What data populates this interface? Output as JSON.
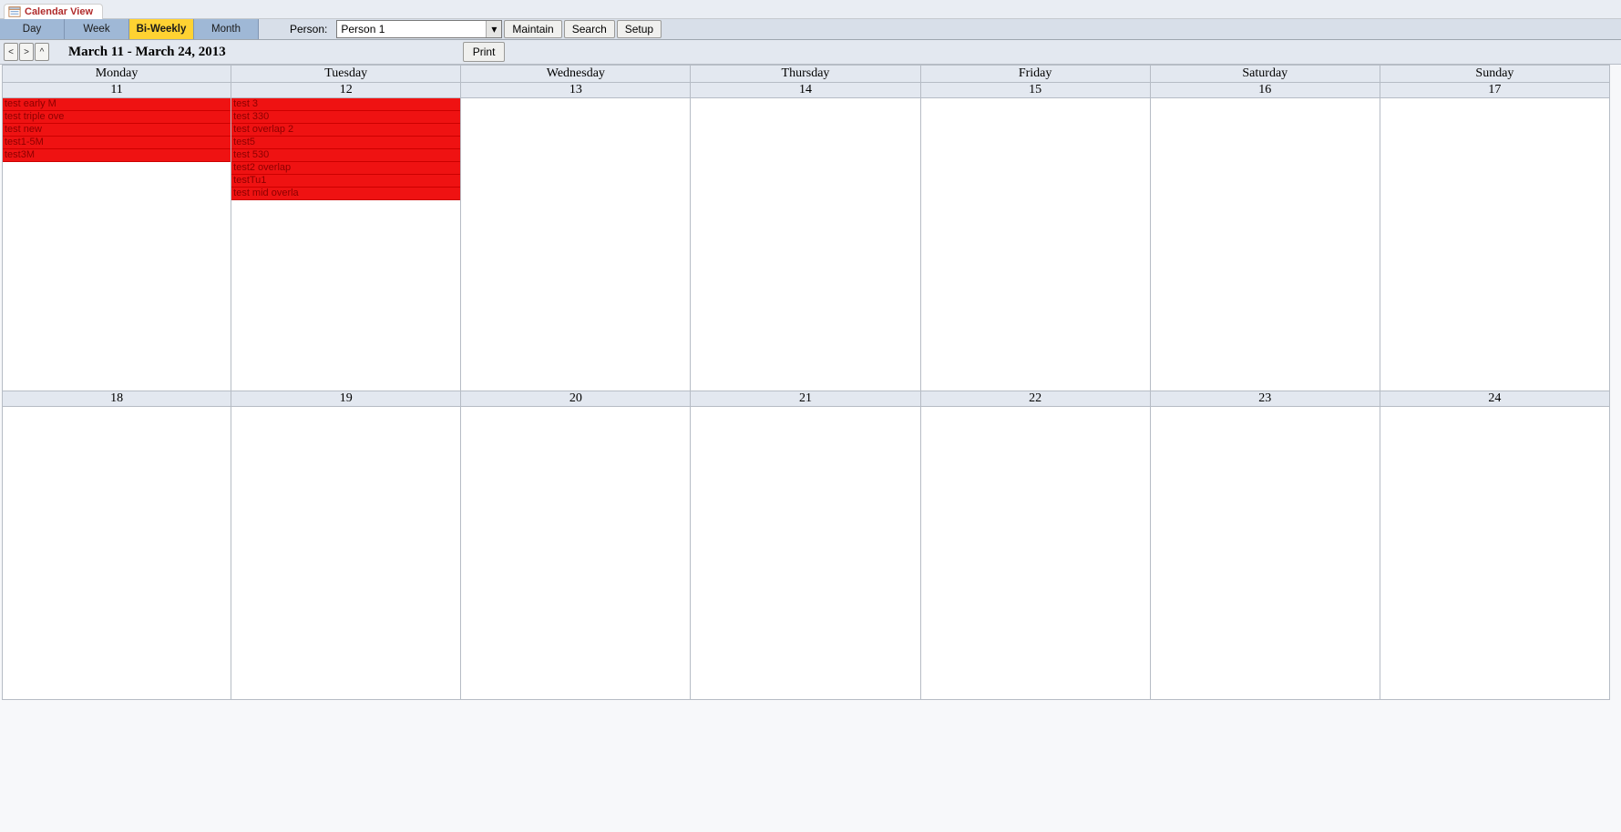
{
  "tab": {
    "title": "Calendar View"
  },
  "views": {
    "day": "Day",
    "week": "Week",
    "biweekly": "Bi-Weekly",
    "month": "Month"
  },
  "toolbar": {
    "person_label": "Person:",
    "person_selected": "Person 1",
    "maintain": "Maintain",
    "search": "Search",
    "setup": "Setup",
    "print": "Print"
  },
  "range": "March 11 - March 24, 2013",
  "day_names": [
    "Monday",
    "Tuesday",
    "Wednesday",
    "Thursday",
    "Friday",
    "Saturday",
    "Sunday"
  ],
  "week1_dates": [
    "11",
    "12",
    "13",
    "14",
    "15",
    "16",
    "17"
  ],
  "week2_dates": [
    "18",
    "19",
    "20",
    "21",
    "22",
    "23",
    "24"
  ],
  "events": {
    "mon11": [
      "test early M",
      "test triple ove",
      "test new",
      "test1-5M",
      "test3M"
    ],
    "tue12": [
      "test 3",
      "test 330",
      "test overlap 2",
      "test5",
      "test 530",
      "test2 overlap",
      "testTu1",
      "test mid overla"
    ]
  }
}
